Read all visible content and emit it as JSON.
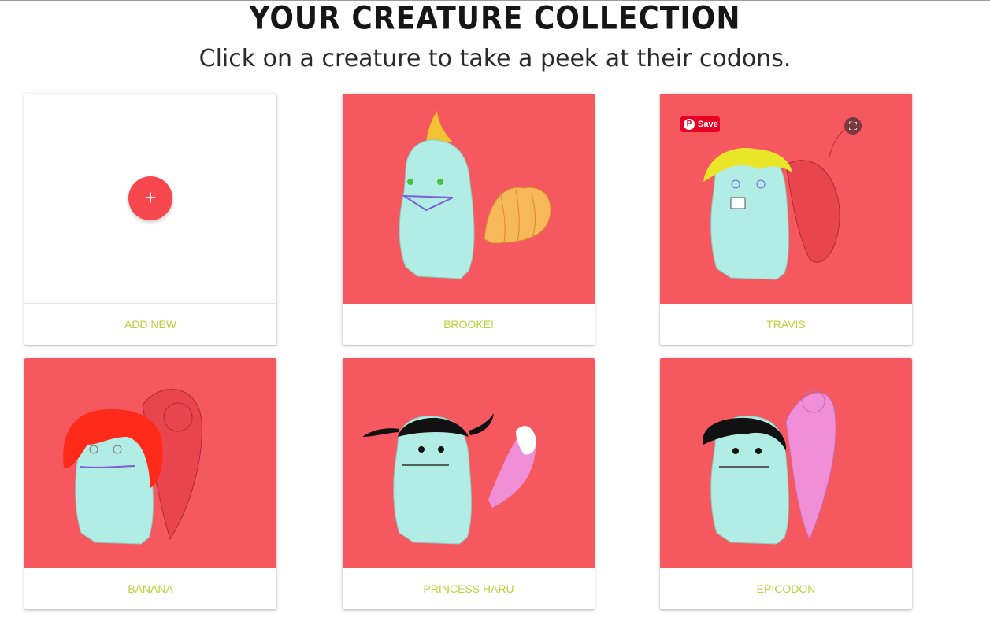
{
  "header": {
    "title": "YOUR CREATURE COLLECTION",
    "subtitle": "Click on a creature to take a peek at their codons."
  },
  "colors": {
    "card_background": "#f6585f",
    "label": "#b9d234",
    "add_button": "#f6474f",
    "creature_body": "#b2ede5"
  },
  "add_card": {
    "label": "ADD NEW",
    "button_glyph": "+"
  },
  "pinterest": {
    "save_label": "Save"
  },
  "creatures": [
    {
      "name": "BROOKE!"
    },
    {
      "name": "TRAVIS"
    },
    {
      "name": "BANANA"
    },
    {
      "name": "PRINCESS HARU"
    },
    {
      "name": "EPICODON"
    }
  ]
}
